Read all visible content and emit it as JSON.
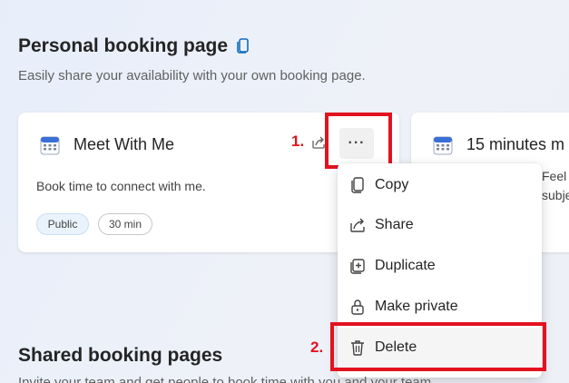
{
  "personal": {
    "title": "Personal booking page",
    "subtitle": "Easily share your availability with your own booking page."
  },
  "cards": [
    {
      "title": "Meet With Me",
      "description": "Book time to connect with me.",
      "visibility": "Public",
      "duration": "30 min"
    },
    {
      "title": "15 minutes m",
      "description_line1": "Feel",
      "description_line2": "subje"
    }
  ],
  "more_button_label": "···",
  "annotations": {
    "step1": "1.",
    "step2": "2."
  },
  "menu": {
    "items": [
      {
        "label": "Copy",
        "icon": "copy-icon"
      },
      {
        "label": "Share",
        "icon": "share-icon"
      },
      {
        "label": "Duplicate",
        "icon": "duplicate-icon"
      },
      {
        "label": "Make private",
        "icon": "lock-icon"
      },
      {
        "label": "Delete",
        "icon": "trash-icon"
      }
    ]
  },
  "shared": {
    "title": "Shared booking pages",
    "subtitle": "Invite your team and get people to book time with you and your team"
  },
  "colors": {
    "annotation_red": "#e3121f",
    "accent_blue": "#0f6cbd"
  }
}
